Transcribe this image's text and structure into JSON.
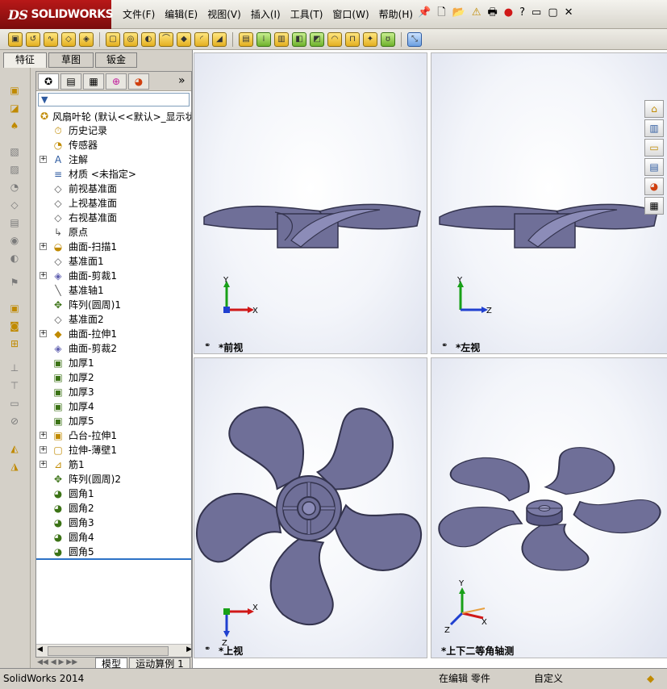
{
  "app": {
    "logo": "SOLIDWORKS",
    "logo_mark": "DS"
  },
  "menu": [
    "文件(F)",
    "编辑(E)",
    "视图(V)",
    "插入(I)",
    "工具(T)",
    "窗口(W)",
    "帮助(H)"
  ],
  "cm_tabs": [
    "特征",
    "草图",
    "钣金"
  ],
  "tree": {
    "root": "风扇叶轮  (默认<<默认>_显示状",
    "filter_icon": "filter-icon",
    "items": [
      {
        "label": "历史记录",
        "icon": "history-icon",
        "expand": false
      },
      {
        "label": "传感器",
        "icon": "sensor-icon",
        "expand": false
      },
      {
        "label": "注解",
        "icon": "annotation-icon",
        "expand": true
      },
      {
        "label": "材质 <未指定>",
        "icon": "material-icon",
        "expand": false
      },
      {
        "label": "前视基准面",
        "icon": "plane-icon",
        "expand": false
      },
      {
        "label": "上视基准面",
        "icon": "plane-icon",
        "expand": false
      },
      {
        "label": "右视基准面",
        "icon": "plane-icon",
        "expand": false
      },
      {
        "label": "原点",
        "icon": "origin-icon",
        "expand": false
      },
      {
        "label": "曲面-扫描1",
        "icon": "surface-sweep-icon",
        "expand": true
      },
      {
        "label": "基准面1",
        "icon": "plane-icon",
        "expand": false
      },
      {
        "label": "曲面-剪裁1",
        "icon": "surface-trim-icon",
        "expand": true
      },
      {
        "label": "基准轴1",
        "icon": "axis-icon",
        "expand": false
      },
      {
        "label": "阵列(圆周)1",
        "icon": "pattern-icon",
        "expand": false
      },
      {
        "label": "基准面2",
        "icon": "plane-icon",
        "expand": false
      },
      {
        "label": "曲面-拉伸1",
        "icon": "surface-extrude-icon",
        "expand": true
      },
      {
        "label": "曲面-剪裁2",
        "icon": "surface-trim-icon",
        "expand": false
      },
      {
        "label": "加厚1",
        "icon": "thicken-icon",
        "expand": false
      },
      {
        "label": "加厚2",
        "icon": "thicken-icon",
        "expand": false
      },
      {
        "label": "加厚3",
        "icon": "thicken-icon",
        "expand": false
      },
      {
        "label": "加厚4",
        "icon": "thicken-icon",
        "expand": false
      },
      {
        "label": "加厚5",
        "icon": "thicken-icon",
        "expand": false
      },
      {
        "label": "凸台-拉伸1",
        "icon": "boss-extrude-icon",
        "expand": true
      },
      {
        "label": "拉伸-薄壁1",
        "icon": "thin-extrude-icon",
        "expand": true
      },
      {
        "label": "筋1",
        "icon": "rib-icon",
        "expand": true
      },
      {
        "label": "阵列(圆周)2",
        "icon": "pattern-icon",
        "expand": false
      },
      {
        "label": "圆角1",
        "icon": "fillet-icon",
        "expand": false
      },
      {
        "label": "圆角2",
        "icon": "fillet-icon",
        "expand": false
      },
      {
        "label": "圆角3",
        "icon": "fillet-icon",
        "expand": false
      },
      {
        "label": "圆角4",
        "icon": "fillet-icon",
        "expand": false
      },
      {
        "label": "圆角5",
        "icon": "fillet-icon",
        "expand": false
      }
    ]
  },
  "bottom_tabs": [
    "模型",
    "运动算例 1"
  ],
  "views": [
    {
      "label": "*前视",
      "axes": [
        "Y",
        "X"
      ]
    },
    {
      "label": "*左视",
      "axes": [
        "Y",
        "Z"
      ]
    },
    {
      "label": "*上视",
      "axes": [
        "X",
        "Z"
      ]
    },
    {
      "label": "*上下二等角轴测",
      "axes": [
        "Y",
        "X",
        "Z"
      ]
    }
  ],
  "status": {
    "app": "SolidWorks 2014",
    "editing": "在编辑 零件",
    "units": "自定义"
  },
  "colors": {
    "blade": "#6f6f98",
    "blade_dark": "#4a4a70",
    "blade_light": "#9898c0",
    "axis_x": "#d01818",
    "axis_y": "#18a018",
    "axis_z": "#2040d0"
  }
}
